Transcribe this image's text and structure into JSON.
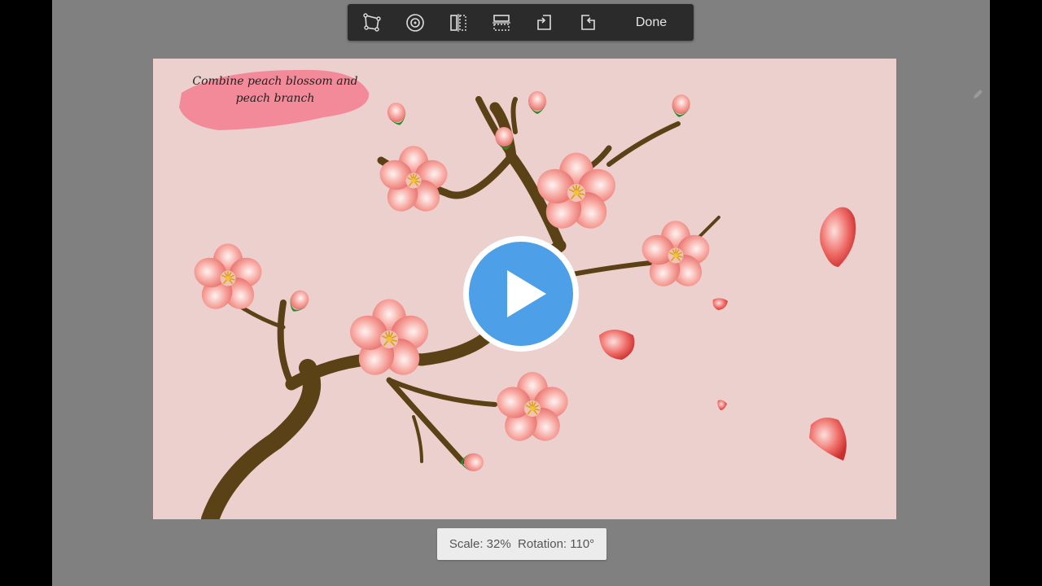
{
  "toolbar": {
    "tools": [
      {
        "name": "distort-tool-icon"
      },
      {
        "name": "warp-tool-icon"
      },
      {
        "name": "flip-horizontal-icon"
      },
      {
        "name": "flip-vertical-icon"
      },
      {
        "name": "rotate-left-icon"
      },
      {
        "name": "rotate-right-icon"
      }
    ],
    "done_label": "Done"
  },
  "canvas": {
    "caption": "Combine peach blossom and\npeach branch",
    "background_color": "#ecd0cd",
    "caption_brush_color": "#f28a9a"
  },
  "video": {
    "play_icon": "play-icon",
    "play_color": "#4d9fe8"
  },
  "status": {
    "scale_text": "Scale: 32%",
    "rotation_text": "Rotation: 110°"
  }
}
